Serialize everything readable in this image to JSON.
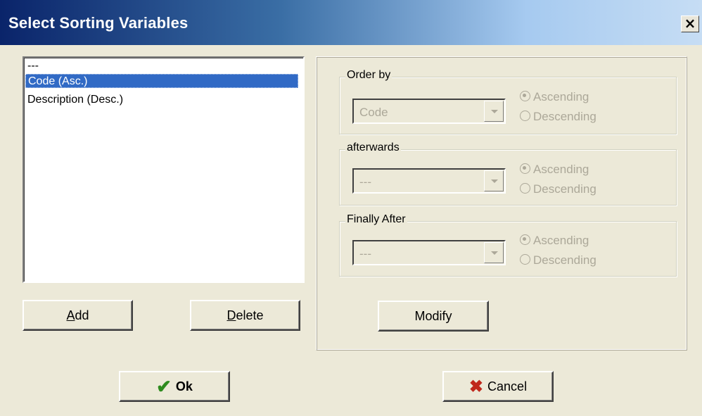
{
  "window": {
    "title": "Select Sorting Variables",
    "close_label": "×"
  },
  "sort_list": {
    "items": [
      {
        "label": "---"
      },
      {
        "label": "Code (Asc.)"
      },
      {
        "label": "Description (Desc.)"
      }
    ],
    "selected": "Code (Asc.)"
  },
  "buttons": {
    "add_prefix": "",
    "add_mnemonic": "A",
    "add_rest": "dd",
    "delete_prefix": "",
    "delete_mnemonic": "D",
    "delete_rest": "elete",
    "modify": "Modify",
    "ok": "Ok",
    "cancel": "Cancel"
  },
  "groups": [
    {
      "label": "Order by",
      "combo_value": "Code",
      "ascending": "Ascending",
      "descending": "Descending",
      "checked": "ascending"
    },
    {
      "label": "afterwards",
      "combo_value": "---",
      "ascending": "Ascending",
      "descending": "Descending",
      "checked": "ascending"
    },
    {
      "label": "Finally After",
      "combo_value": "---",
      "ascending": "Ascending",
      "descending": "Descending",
      "checked": "ascending"
    }
  ],
  "icons": {
    "ok": "check-icon",
    "cancel": "x-icon",
    "combo": "chevron-down-icon"
  },
  "colors": {
    "title_start": "#0A246A",
    "selection": "#316AC5",
    "disabled_text": "#ACA899",
    "ok_icon": "#2E8B1E",
    "cancel_icon": "#C0281C"
  }
}
